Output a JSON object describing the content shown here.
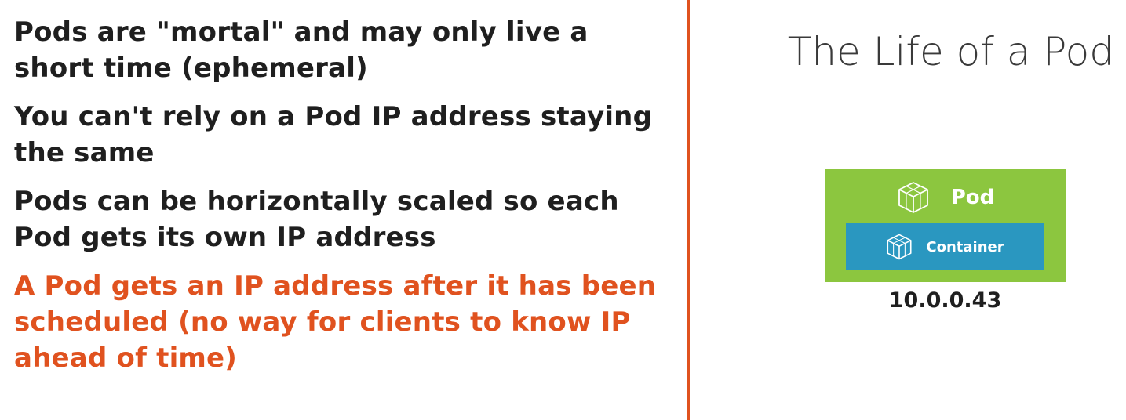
{
  "bullets": [
    {
      "text": "Pods are \"mortal\" and may only live a short time (ephemeral)",
      "highlight": false
    },
    {
      "text": "You can't rely on a Pod IP address staying the same",
      "highlight": false
    },
    {
      "text": "Pods can be horizontally scaled so each Pod gets its own IP address",
      "highlight": false
    },
    {
      "text": "A Pod gets an IP address after it has been scheduled (no way for clients to know IP ahead of time)",
      "highlight": true
    }
  ],
  "title": "The Life of a Pod",
  "diagram": {
    "pod_label": "Pod",
    "pod_icon": "cube-icon",
    "container_label": "Container",
    "container_icon": "cube-icon",
    "ip_address": "10.0.0.43"
  },
  "colors": {
    "accent": "#e0521f",
    "pod_green": "#8cc63f",
    "container_blue": "#2a97c0",
    "text": "#1f1f1f"
  }
}
